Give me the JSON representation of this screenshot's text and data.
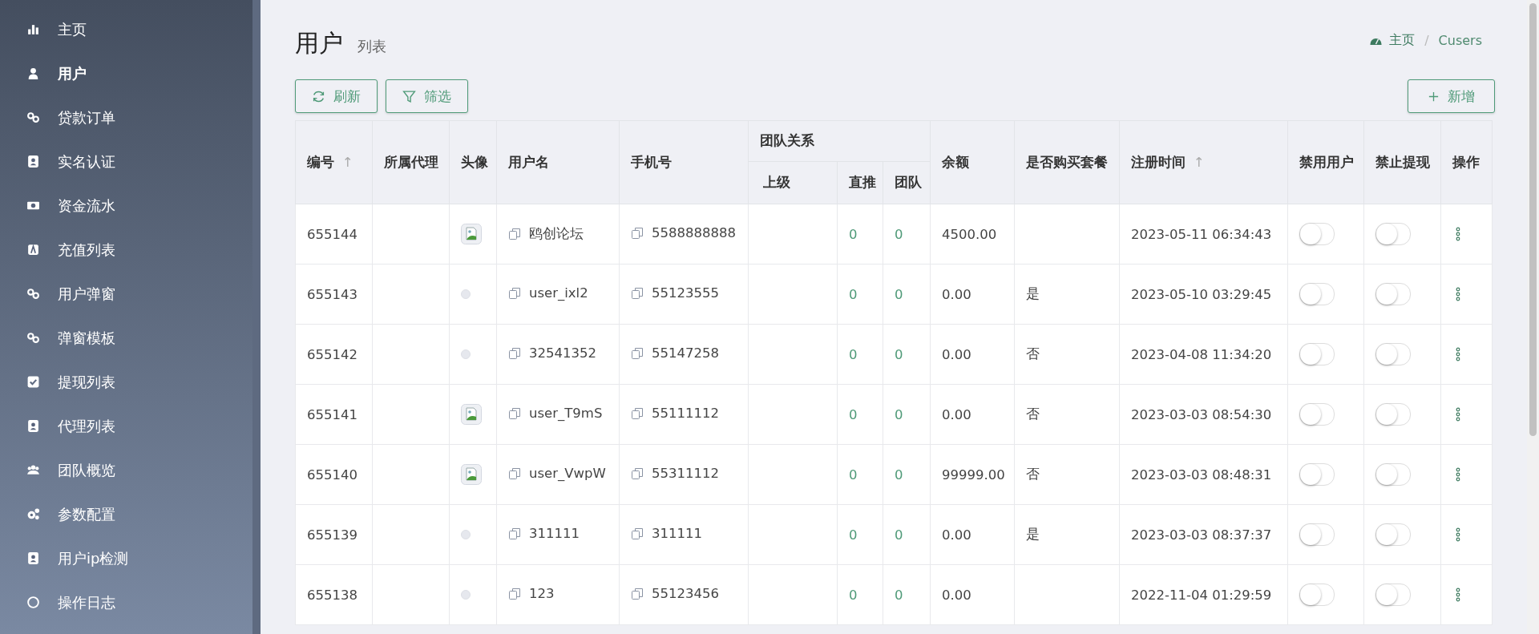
{
  "sidebar": {
    "items": [
      {
        "label": "主页",
        "selected": false
      },
      {
        "label": "用户",
        "selected": true
      },
      {
        "label": "贷款订单",
        "selected": false
      },
      {
        "label": "实名认证",
        "selected": false
      },
      {
        "label": "资金流水",
        "selected": false
      },
      {
        "label": "充值列表",
        "selected": false
      },
      {
        "label": "用户弹窗",
        "selected": false
      },
      {
        "label": "弹窗模板",
        "selected": false
      },
      {
        "label": "提现列表",
        "selected": false
      },
      {
        "label": "代理列表",
        "selected": false
      },
      {
        "label": "团队概览",
        "selected": false
      },
      {
        "label": "参数配置",
        "selected": false
      },
      {
        "label": "用户ip检测",
        "selected": false
      },
      {
        "label": "操作日志",
        "selected": false
      }
    ]
  },
  "page": {
    "title": "用户",
    "subtitle": "列表"
  },
  "breadcrumb": [
    "主页",
    "Cusers"
  ],
  "breadcrumb_separator": "/",
  "toolbar": {
    "left": [
      "刷新",
      "筛选"
    ],
    "right": "新增"
  },
  "table": {
    "columns": [
      {
        "label": "编号",
        "sort_icon": "↑"
      },
      {
        "label": "所属代理"
      },
      {
        "label": "头像"
      },
      {
        "label": "用户名"
      },
      {
        "label": "手机号"
      },
      {
        "label": "团队关系",
        "children": [
          "上级",
          "直推",
          "团队"
        ]
      },
      {
        "label": "余额"
      },
      {
        "label": "是否购买套餐"
      },
      {
        "label": "注册时间",
        "sort_icon": "↑"
      },
      {
        "label": "禁用用户"
      },
      {
        "label": "禁止提现"
      },
      {
        "label": "操作"
      }
    ],
    "rows": [
      {
        "id": "655144",
        "avatar": true,
        "username": "鸥创论坛",
        "phone": "5588888888",
        "direct": "0",
        "team": "0",
        "balance": "4500.00",
        "time": "2023-05-11 06:34:43",
        "disabled": false,
        "no_withdraw": false
      },
      {
        "id": "655143",
        "avatar": false,
        "username": "user_ixl2",
        "phone": "55123555",
        "direct": "0",
        "team": "0",
        "balance": "0.00",
        "package": "是",
        "time": "2023-05-10 03:29:45",
        "disabled": false,
        "no_withdraw": false
      },
      {
        "id": "655142",
        "avatar": false,
        "username": "32541352",
        "phone": "55147258",
        "direct": "0",
        "team": "0",
        "balance": "0.00",
        "package": "否",
        "time": "2023-04-08 11:34:20",
        "disabled": false,
        "no_withdraw": false
      },
      {
        "id": "655141",
        "avatar": true,
        "username": "user_T9mS",
        "phone": "55111112",
        "direct": "0",
        "team": "0",
        "balance": "0.00",
        "package": "否",
        "time": "2023-03-03 08:54:30",
        "disabled": false,
        "no_withdraw": false
      },
      {
        "id": "655140",
        "avatar": true,
        "username": "user_VwpW",
        "phone": "55311112",
        "direct": "0",
        "team": "0",
        "balance": "99999.00",
        "package": "否",
        "time": "2023-03-03 08:48:31",
        "disabled": false,
        "no_withdraw": false
      },
      {
        "id": "655139",
        "avatar": false,
        "username": "311111",
        "phone": "311111",
        "direct": "0",
        "team": "0",
        "balance": "0.00",
        "package": "是",
        "time": "2023-03-03 08:37:37",
        "disabled": false,
        "no_withdraw": false
      },
      {
        "id": "655138",
        "avatar": false,
        "username": "123",
        "phone": "55123456",
        "direct": "0",
        "team": "0",
        "balance": "0.00",
        "time": "2022-11-04 01:29:59",
        "disabled": false,
        "no_withdraw": false
      }
    ]
  }
}
